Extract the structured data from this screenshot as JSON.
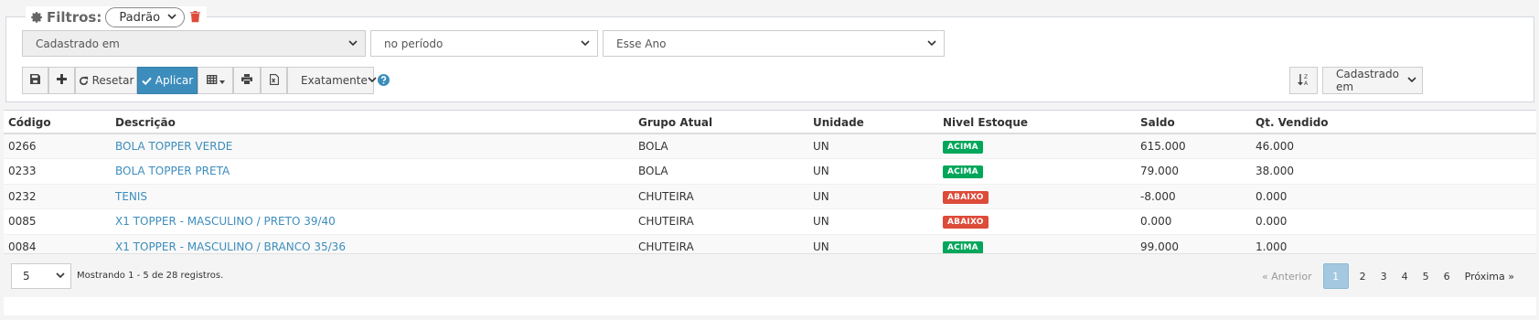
{
  "filters": {
    "title": "Filtros:",
    "preset": "Padrão",
    "field": "Cadastrado em",
    "operator": "no período",
    "value": "Esse Ano",
    "reset_label": "Resetar",
    "apply_label": "Aplicar",
    "match_mode": "Exatamente",
    "sort_field": "Cadastrado em"
  },
  "table": {
    "headers": [
      "Código",
      "Descrição",
      "Grupo Atual",
      "Unidade",
      "Nivel Estoque",
      "Saldo",
      "Qt. Vendido"
    ],
    "rows": [
      {
        "code": "0266",
        "description": "BOLA TOPPER VERDE",
        "group": "BOLA",
        "unit": "UN",
        "stock_level": "ACIMA",
        "balance": "615.000",
        "sold": "46.000"
      },
      {
        "code": "0233",
        "description": "BOLA TOPPER PRETA",
        "group": "BOLA",
        "unit": "UN",
        "stock_level": "ACIMA",
        "balance": "79.000",
        "sold": "38.000"
      },
      {
        "code": "0232",
        "description": "TENIS",
        "group": "CHUTEIRA",
        "unit": "UN",
        "stock_level": "ABAIXO",
        "balance": "-8.000",
        "sold": "0.000"
      },
      {
        "code": "0085",
        "description": "X1 TOPPER - MASCULINO / PRETO 39/40",
        "group": "CHUTEIRA",
        "unit": "UN",
        "stock_level": "ABAIXO",
        "balance": "0.000",
        "sold": "0.000"
      },
      {
        "code": "0084",
        "description": "X1 TOPPER - MASCULINO / BRANCO 35/36",
        "group": "CHUTEIRA",
        "unit": "UN",
        "stock_level": "ACIMA",
        "balance": "99.000",
        "sold": "1.000"
      }
    ]
  },
  "footer": {
    "page_size": "5",
    "showing": "Mostrando 1 - 5 de 28 registros.",
    "prev": "« Anterior",
    "pages": [
      "1",
      "2",
      "3",
      "4",
      "5",
      "6"
    ],
    "next": "Próxima »"
  },
  "colors": {
    "accent": "#3c8dbc",
    "above": "#00a65a",
    "below": "#dd4b39"
  }
}
